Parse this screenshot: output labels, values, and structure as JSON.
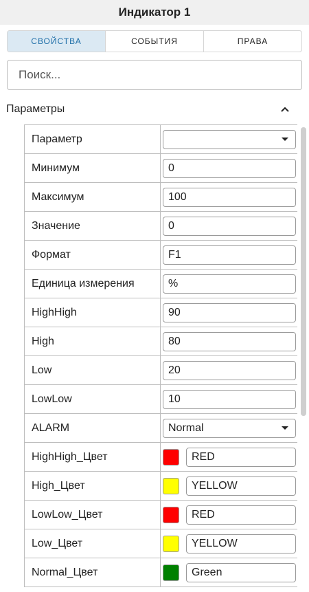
{
  "panel": {
    "title": "Индикатор 1"
  },
  "tabs": [
    {
      "label": "СВОЙСТВА",
      "active": true
    },
    {
      "label": "СОБЫТИЯ",
      "active": false
    },
    {
      "label": "ПРАВА",
      "active": false
    }
  ],
  "search": {
    "placeholder": "Поиск..."
  },
  "section": {
    "title": "Параметры",
    "icon": "chevron-up-icon"
  },
  "params": {
    "parameter": {
      "label": "Параметр",
      "value": ""
    },
    "minimum": {
      "label": "Минимум",
      "value": "0"
    },
    "maximum": {
      "label": "Максимум",
      "value": "100"
    },
    "value": {
      "label": "Значение",
      "value": "0"
    },
    "format": {
      "label": "Формат",
      "value": "F1"
    },
    "unit": {
      "label": "Единица измерения",
      "value": "%"
    },
    "highhigh": {
      "label": "HighHigh",
      "value": "90"
    },
    "high": {
      "label": "High",
      "value": "80"
    },
    "low": {
      "label": "Low",
      "value": "20"
    },
    "lowlow": {
      "label": "LowLow",
      "value": "10"
    },
    "alarm": {
      "label": "ALARM",
      "value": "Normal"
    },
    "highhigh_color": {
      "label": "HighHigh_Цвет",
      "value": "RED",
      "color": "#ff0000"
    },
    "high_color": {
      "label": "High_Цвет",
      "value": "YELLOW",
      "color": "#ffff00"
    },
    "lowlow_color": {
      "label": "LowLow_Цвет",
      "value": "RED",
      "color": "#ff0000"
    },
    "low_color": {
      "label": "Low_Цвет",
      "value": "YELLOW",
      "color": "#ffff00"
    },
    "normal_color": {
      "label": "Normal_Цвет",
      "value": "Green",
      "color": "#008000"
    }
  },
  "colors": {
    "accent": "#1f6fa8",
    "active_tab_bg": "#dbe9f3",
    "header_bg": "#f0f0f0"
  }
}
